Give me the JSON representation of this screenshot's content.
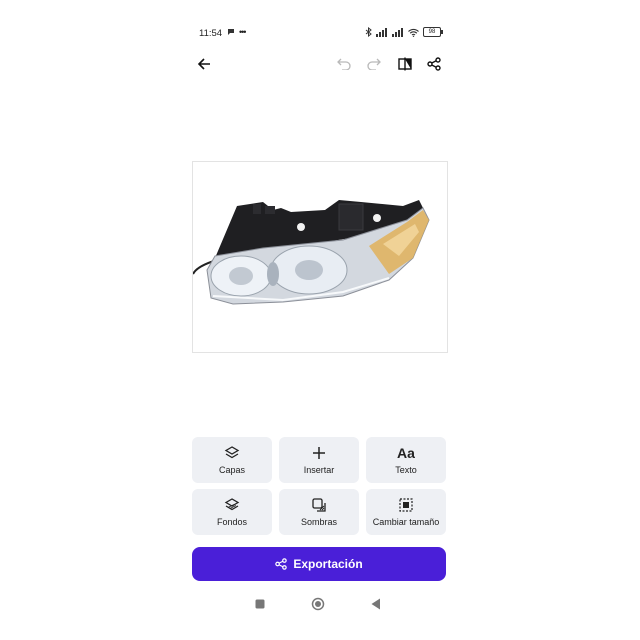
{
  "status_bar": {
    "time": "11:54",
    "battery": "98"
  },
  "toolbar": {
    "back": "back-arrow-icon",
    "undo": "undo-icon",
    "redo": "redo-icon",
    "compare": "compare-icon",
    "share": "share-icon"
  },
  "tiles": [
    {
      "label": "Capas",
      "icon": "layers-icon"
    },
    {
      "label": "Insertar",
      "icon": "plus-icon"
    },
    {
      "label": "Texto",
      "icon_text": "Aa"
    },
    {
      "label": "Fondos",
      "icon": "background-layers-icon"
    },
    {
      "label": "Sombras",
      "icon": "shadow-icon"
    },
    {
      "label": "Cambiar tamaño",
      "icon": "resize-icon"
    }
  ],
  "export_button": {
    "label": "Exportación",
    "icon": "share-icon"
  },
  "colors": {
    "accent": "#4a1fd8",
    "tile_bg": "#eef0f4"
  }
}
